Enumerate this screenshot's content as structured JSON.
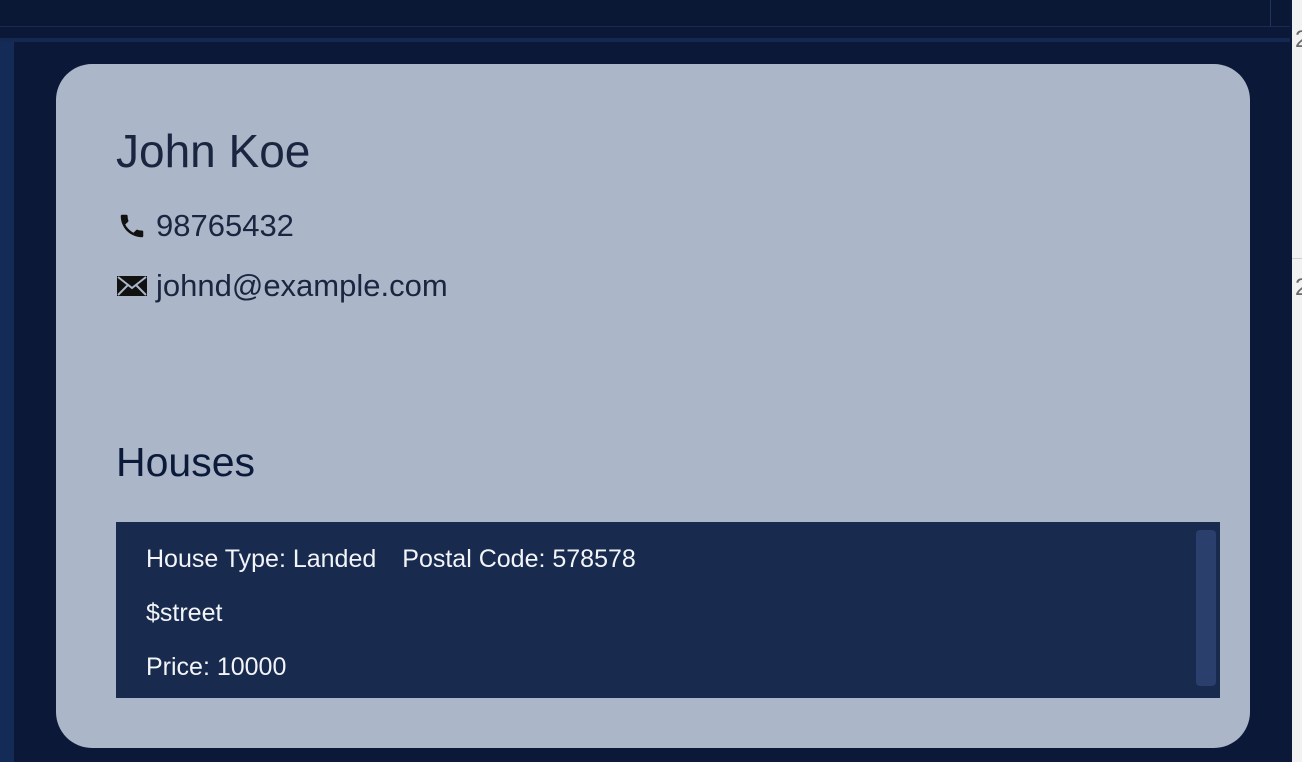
{
  "person": {
    "name": "John Koe",
    "phone": "98765432",
    "email": "johnd@example.com"
  },
  "houses_section": {
    "title": "Houses",
    "items": [
      {
        "house_type": "House Type: Landed",
        "postal_code": "Postal Code: 578578",
        "street": "$street",
        "price": "Price: 10000"
      }
    ]
  },
  "icons": {
    "phone": "phone-icon",
    "email": "envelope-icon"
  },
  "right_edge_glyph": "2",
  "colors": {
    "background": "#0b1838",
    "card": "#abb6c9",
    "list_background": "#182a4e",
    "text_dark": "#1a2540",
    "text_light": "#f2f4f8"
  }
}
